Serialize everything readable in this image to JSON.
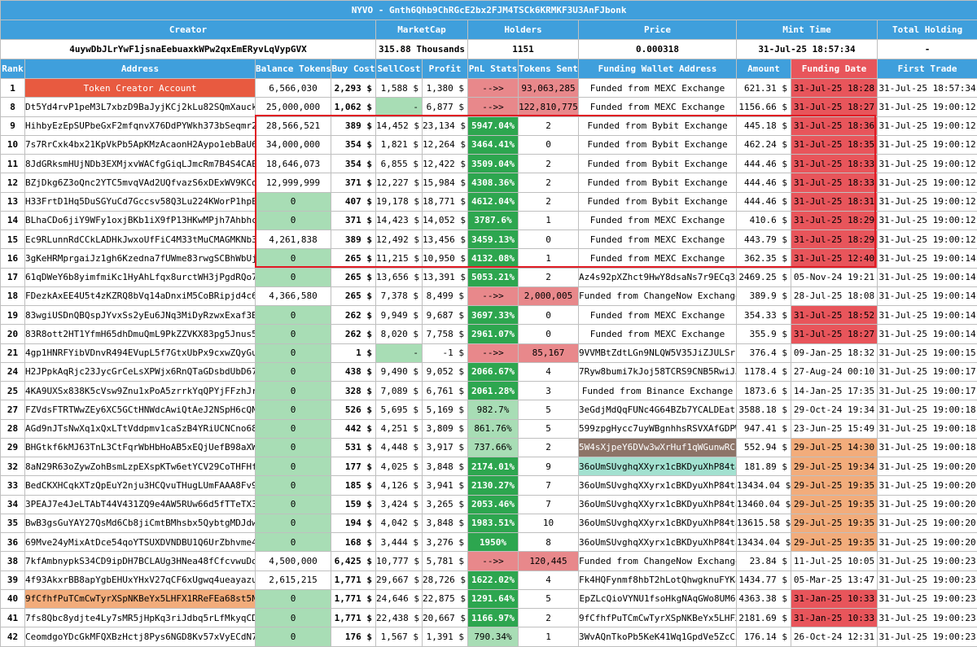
{
  "token": {
    "title": "NYVO - Gnth6Qhb9ChRGcE2bx2FJM4TSCk6KRMKF3U3AnFJbonk",
    "headers": {
      "creator": "Creator",
      "marketcap": "MarketCap",
      "holders": "Holders",
      "price": "Price",
      "mint_time": "Mint Time",
      "total_holding": "Total Holding"
    },
    "creator": "4uywDbJLrYwF1jsnaEebuaxkWPw2qxEmERyvLqVypGVX",
    "marketcap": "315.88 Thousands",
    "holders": "1151",
    "price": "0.000318",
    "mint_time": "31-Jul-25 18:57:34",
    "total_holding": "-"
  },
  "columns": [
    "Rank",
    "Address",
    "Balance Tokens",
    "Buy Cost",
    "SellCost",
    "Profit",
    "PnL Stats",
    "Tokens Sent",
    "Funding Wallet Address",
    "Amount",
    "Funding Date",
    "First Trade"
  ],
  "rows": [
    {
      "rank": "1",
      "address": "Token Creator Account",
      "balance": "6,566,030",
      "buy": "2,293 $",
      "sell": "1,588 $",
      "profit": "1,380 $",
      "pnl": "-->>",
      "sent": "93,063,285",
      "funding": "Funded from MEXC Exchange",
      "amount": "621.31 $",
      "fdate": "31-Jul-25 18:28",
      "first": "31-Jul-25 18:57:34",
      "c": {
        "address": "creator",
        "pnl": "pink",
        "sent": "pink",
        "fdate": "red"
      }
    },
    {
      "rank": "8",
      "address": "Dt5Yd4rvP1peM3L7xbzD9BaJyjKCj2kLu82SQmXauck2",
      "balance": "25,000,000",
      "buy": "1,062 $",
      "sell": "-",
      "profit": "6,877 $",
      "pnl": "-->>",
      "sent": "122,810,775",
      "funding": "Funded from MEXC Exchange",
      "amount": "1156.66 $",
      "fdate": "31-Jul-25 18:27",
      "first": "31-Jul-25 19:00:12",
      "c": {
        "sell": "green",
        "pnl": "pink",
        "sent": "pink",
        "fdate": "red"
      }
    },
    {
      "rank": "9",
      "address": "HihbyEzEpSUPbeGxF2mfqnvX76DdPYWkh373bSeqmr2",
      "balance": "28,566,521",
      "buy": "389 $",
      "sell": "14,452 $",
      "profit": "23,134 $",
      "pnl": "5947.04%",
      "sent": "2",
      "funding": "Funded from Bybit Exchange",
      "amount": "445.18 $",
      "fdate": "31-Jul-25 18:36",
      "first": "31-Jul-25 19:00:12",
      "c": {
        "pnl": "strong",
        "fdate": "red"
      }
    },
    {
      "rank": "10",
      "address": "7s7RrCxk4bx21KpVkPb5ApKMzAcaonH2Aypo1ebBaU6J",
      "balance": "34,000,000",
      "buy": "354 $",
      "sell": "1,821 $",
      "profit": "12,264 $",
      "pnl": "3464.41%",
      "sent": "0",
      "funding": "Funded from Bybit Exchange",
      "amount": "462.24 $",
      "fdate": "31-Jul-25 18:35",
      "first": "31-Jul-25 19:00:12",
      "c": {
        "pnl": "strong",
        "fdate": "red"
      }
    },
    {
      "rank": "11",
      "address": "8JdGRksmHUjNDb3EXMjxvWACfgGiqLJmcRm7B4S4CAE8",
      "balance": "18,646,073",
      "buy": "354 $",
      "sell": "6,855 $",
      "profit": "12,422 $",
      "pnl": "3509.04%",
      "sent": "2",
      "funding": "Funded from Bybit Exchange",
      "amount": "444.46 $",
      "fdate": "31-Jul-25 18:33",
      "first": "31-Jul-25 19:00:12",
      "c": {
        "pnl": "strong",
        "fdate": "red"
      }
    },
    {
      "rank": "12",
      "address": "BZjDkg6Z3oQnc2YTC5mvqVAd2UQfvazS6xDExWV9KCd",
      "balance": "12,999,999",
      "buy": "371 $",
      "sell": "12,227 $",
      "profit": "15,984 $",
      "pnl": "4308.36%",
      "sent": "2",
      "funding": "Funded from Bybit Exchange",
      "amount": "444.46 $",
      "fdate": "31-Jul-25 18:33",
      "first": "31-Jul-25 19:00:12",
      "c": {
        "pnl": "strong",
        "fdate": "red"
      }
    },
    {
      "rank": "13",
      "address": "H33FrtD1Hq5DuSGYuCd7Gccsv58Q3Lu224KWorP1hpEn",
      "balance": "0",
      "buy": "407 $",
      "sell": "19,178 $",
      "profit": "18,771 $",
      "pnl": "4612.04%",
      "sent": "2",
      "funding": "Funded from Bybit Exchange",
      "amount": "444.46 $",
      "fdate": "31-Jul-25 18:31",
      "first": "31-Jul-25 19:00:12",
      "c": {
        "balance": "green",
        "pnl": "strong",
        "fdate": "red"
      }
    },
    {
      "rank": "14",
      "address": "BLhaCDo6jiY9WFy1oxjBKb1iX9fP13HKwMPjh7Ahbhco",
      "balance": "0",
      "buy": "371 $",
      "sell": "14,423 $",
      "profit": "14,052 $",
      "pnl": "3787.6%",
      "sent": "1",
      "funding": "Funded from MEXC Exchange",
      "amount": "410.6 $",
      "fdate": "31-Jul-25 18:29",
      "first": "31-Jul-25 19:00:12",
      "c": {
        "balance": "green",
        "pnl": "strong",
        "fdate": "red"
      }
    },
    {
      "rank": "15",
      "address": "Ec9RLunnRdCCkLADHkJwxoUfFiC4M33tMuCMAGMKNb3d",
      "balance": "4,261,838",
      "buy": "389 $",
      "sell": "12,492 $",
      "profit": "13,456 $",
      "pnl": "3459.13%",
      "sent": "0",
      "funding": "Funded from MEXC Exchange",
      "amount": "443.79 $",
      "fdate": "31-Jul-25 18:29",
      "first": "31-Jul-25 19:00:12",
      "c": {
        "pnl": "strong",
        "fdate": "red"
      }
    },
    {
      "rank": "16",
      "address": "3gKeHRMprgaiJz1gh6Kzedna7fUWme83rwgSCBhWbUjM",
      "balance": "0",
      "buy": "265 $",
      "sell": "11,215 $",
      "profit": "10,950 $",
      "pnl": "4132.08%",
      "sent": "1",
      "funding": "Funded from MEXC Exchange",
      "amount": "362.35 $",
      "fdate": "31-Jul-25 12:40",
      "first": "31-Jul-25 19:00:14",
      "c": {
        "balance": "green",
        "pnl": "strong",
        "fdate": "red"
      }
    },
    {
      "rank": "17",
      "address": "61qDWeY6b8yimfmiKc1HyAhLfqx8urctWH3jPgdRQo7Y",
      "balance": "0",
      "buy": "265 $",
      "sell": "13,656 $",
      "profit": "13,391 $",
      "pnl": "5053.21%",
      "sent": "2",
      "funding": "Az4s92pXZhct9HwY8dsaNs7r9ECq35",
      "amount": "2469.25 $",
      "fdate": "05-Nov-24 19:21",
      "first": "31-Jul-25 19:00:14",
      "c": {
        "balance": "green",
        "pnl": "strong"
      }
    },
    {
      "rank": "18",
      "address": "FDezkAxEE4U5t4zKZRQ8bVq14aDnxiM5CoBRipjd4c6b",
      "balance": "4,366,580",
      "buy": "265 $",
      "sell": "7,378 $",
      "profit": "8,499 $",
      "pnl": "-->>",
      "sent": "2,000,005",
      "funding": "Funded from ChangeNow Exchange",
      "amount": "389.9 $",
      "fdate": "28-Jul-25 18:08",
      "first": "31-Jul-25 19:00:14",
      "c": {
        "pnl": "pink",
        "sent": "pink"
      }
    },
    {
      "rank": "19",
      "address": "83wgiUSDnQBQspJYvxSs2yEu6JNq3MiDyRzwxExaf3B7",
      "balance": "0",
      "buy": "262 $",
      "sell": "9,949 $",
      "profit": "9,687 $",
      "pnl": "3697.33%",
      "sent": "0",
      "funding": "Funded from MEXC Exchange",
      "amount": "354.33 $",
      "fdate": "31-Jul-25 18:52",
      "first": "31-Jul-25 19:00:14",
      "c": {
        "balance": "green",
        "pnl": "strong",
        "fdate": "red"
      }
    },
    {
      "rank": "20",
      "address": "83R8ott2HT1YfmH65dhDmuQmL9PkZZVKX83pg5Jnus5g",
      "balance": "0",
      "buy": "262 $",
      "sell": "8,020 $",
      "profit": "7,758 $",
      "pnl": "2961.07%",
      "sent": "0",
      "funding": "Funded from MEXC Exchange",
      "amount": "355.9 $",
      "fdate": "31-Jul-25 18:27",
      "first": "31-Jul-25 19:00:14",
      "c": {
        "balance": "green",
        "pnl": "strong",
        "fdate": "red"
      }
    },
    {
      "rank": "21",
      "address": "4gp1HNRFYibVDnvR494EVupL5f7GtxUbPx9cxwZQyGuA",
      "balance": "0",
      "buy": "1 $",
      "sell": "-",
      "profit": "-1 $",
      "pnl": "-->>",
      "sent": "85,167",
      "funding": "9VVMBtZdtLGn9NLQW5V35JiZJULSrf",
      "amount": "376.4 $",
      "fdate": "09-Jan-25 18:32",
      "first": "31-Jul-25 19:00:15",
      "c": {
        "balance": "green",
        "sell": "green",
        "pnl": "pink",
        "sent": "pink"
      }
    },
    {
      "rank": "24",
      "address": "H2JPpkAqRjc23JycGrCeLsXPWjx6RnQTaGDsbdUbD67P",
      "balance": "0",
      "buy": "438 $",
      "sell": "9,490 $",
      "profit": "9,052 $",
      "pnl": "2066.67%",
      "sent": "4",
      "funding": "7Ryw8bumi7kJoj58TCRS9CNB5RwiJJ",
      "amount": "1178.4 $",
      "fdate": "27-Aug-24 00:10",
      "first": "31-Jul-25 19:00:17",
      "c": {
        "balance": "green",
        "pnl": "strong"
      }
    },
    {
      "rank": "25",
      "address": "4KA9UXSx838K5cVsw9Znu1xPoA5zrrkYqQPYjFFzhJrb",
      "balance": "0",
      "buy": "328 $",
      "sell": "7,089 $",
      "profit": "6,761 $",
      "pnl": "2061.28%",
      "sent": "3",
      "funding": "Funded from Binance Exchange",
      "amount": "1873.6 $",
      "fdate": "14-Jan-25 17:35",
      "first": "31-Jul-25 19:00:17",
      "c": {
        "balance": "green",
        "pnl": "strong"
      }
    },
    {
      "rank": "27",
      "address": "FZVdsFTRTWwZEy6XC5GCtHNWdcAwiQtAeJ2NSpH6cQNz",
      "balance": "0",
      "buy": "526 $",
      "sell": "5,695 $",
      "profit": "5,169 $",
      "pnl": "982.7%",
      "sent": "5",
      "funding": "3eGdjMdQqFUNc4G64BZb7YCALDEatu",
      "amount": "3588.18 $",
      "fdate": "29-Oct-24 19:34",
      "first": "31-Jul-25 19:00:18",
      "c": {
        "balance": "green",
        "pnl": "green"
      }
    },
    {
      "rank": "28",
      "address": "AGd9nJTsNwXq1xQxLTtVddpmv1caSzB4YRiUCNCno68k",
      "balance": "0",
      "buy": "442 $",
      "sell": "4,251 $",
      "profit": "3,809 $",
      "pnl": "861.76%",
      "sent": "5",
      "funding": "599zpgHycc7uyWBgnhhsRSVXAfGDPW",
      "amount": "947.41 $",
      "fdate": "23-Jun-25 15:49",
      "first": "31-Jul-25 19:00:18",
      "c": {
        "balance": "green",
        "pnl": "green"
      }
    },
    {
      "rank": "29",
      "address": "BHGtkf6kMJ63TnL3CtFqrWbHbHoAB5xEQjUefB98aXWk",
      "balance": "0",
      "buy": "531 $",
      "sell": "4,448 $",
      "profit": "3,917 $",
      "pnl": "737.66%",
      "sent": "2",
      "funding": "5W4sXjpeY6DVw3wXrHuf1qWGunwRCj",
      "amount": "552.94 $",
      "fdate": "29-Jul-25 14:30",
      "first": "31-Jul-25 19:00:18",
      "c": {
        "balance": "green",
        "pnl": "green",
        "funding": "brown",
        "fdate": "orange"
      }
    },
    {
      "rank": "32",
      "address": "8aN29R63oZywZohBsmLzpEXspKTw6etYCV29CoTHFHf7",
      "balance": "0",
      "buy": "177 $",
      "sell": "4,025 $",
      "profit": "3,848 $",
      "pnl": "2174.01%",
      "sent": "9",
      "funding": "36oUmSUvghqXXyrx1cBKDyuXhP84ta",
      "amount": "181.89 $",
      "fdate": "29-Jul-25 19:34",
      "first": "31-Jul-25 19:00:20",
      "c": {
        "balance": "green",
        "pnl": "strong",
        "funding": "teal",
        "fdate": "orange"
      }
    },
    {
      "rank": "33",
      "address": "BedCKXHCqkXTzQpEuY2nju3HCQvuTHugLUmFAAA8Fv9s",
      "balance": "0",
      "buy": "185 $",
      "sell": "4,126 $",
      "profit": "3,941 $",
      "pnl": "2130.27%",
      "sent": "7",
      "funding": "36oUmSUvghqXXyrx1cBKDyuXhP84ta",
      "amount": "13434.04 $",
      "fdate": "29-Jul-25 19:35",
      "first": "31-Jul-25 19:00:20",
      "c": {
        "balance": "green",
        "pnl": "strong",
        "fdate": "orange"
      }
    },
    {
      "rank": "34",
      "address": "3PEAJ7e4JeLTAbT44V431ZQ9e4AW5RUw66d5fTTeTX3C",
      "balance": "0",
      "buy": "159 $",
      "sell": "3,424 $",
      "profit": "3,265 $",
      "pnl": "2053.46%",
      "sent": "7",
      "funding": "36oUmSUvghqXXyrx1cBKDyuXhP84ta",
      "amount": "13460.04 $",
      "fdate": "29-Jul-25 19:35",
      "first": "31-Jul-25 19:00:20",
      "c": {
        "balance": "green",
        "pnl": "strong",
        "fdate": "orange"
      }
    },
    {
      "rank": "35",
      "address": "BwB3gsGuYAY27QsMd6Cb8jiCmtBMhsbx5QybtgMDJdwt",
      "balance": "0",
      "buy": "194 $",
      "sell": "4,042 $",
      "profit": "3,848 $",
      "pnl": "1983.51%",
      "sent": "10",
      "funding": "36oUmSUvghqXXyrx1cBKDyuXhP84ta",
      "amount": "13615.58 $",
      "fdate": "29-Jul-25 19:35",
      "first": "31-Jul-25 19:00:20",
      "c": {
        "balance": "green",
        "pnl": "strong",
        "fdate": "orange"
      }
    },
    {
      "rank": "36",
      "address": "69Mve24yMixAtDce54qoYTSUXDVNDBU1Q6UrZbhvme4y",
      "balance": "0",
      "buy": "168 $",
      "sell": "3,444 $",
      "profit": "3,276 $",
      "pnl": "1950%",
      "sent": "8",
      "funding": "36oUmSUvghqXXyrx1cBKDyuXhP84ta",
      "amount": "13434.04 $",
      "fdate": "29-Jul-25 19:35",
      "first": "31-Jul-25 19:00:20",
      "c": {
        "balance": "green",
        "pnl": "strong",
        "fdate": "orange"
      }
    },
    {
      "rank": "38",
      "address": "7kfAmbnypkS34CD9ipDH7BCLAUg3HNea48fCfcvwuDon",
      "balance": "4,500,000",
      "buy": "6,425 $",
      "sell": "10,777 $",
      "profit": "5,781 $",
      "pnl": "-->>",
      "sent": "120,445",
      "funding": "Funded from ChangeNow Exchange",
      "amount": "23.84 $",
      "fdate": "11-Jul-25 10:05",
      "first": "31-Jul-25 19:00:23",
      "c": {
        "pnl": "pink",
        "sent": "pink"
      }
    },
    {
      "rank": "39",
      "address": "4f93AkxrBB8apYgbEHUxYHxV27qCF6xUgwq4ueayazu4",
      "balance": "2,615,215",
      "buy": "1,771 $",
      "sell": "29,667 $",
      "profit": "28,726 $",
      "pnl": "1622.02%",
      "sent": "4",
      "funding": "Fk4HQFynmf8hbT2hLotQhwgknuFYKa",
      "amount": "1434.77 $",
      "fdate": "05-Mar-25 13:47",
      "first": "31-Jul-25 19:00:23",
      "c": {
        "pnl": "strong"
      }
    },
    {
      "rank": "40",
      "address": "9fCfhfPuTCmCwTyrXSpNKBeYx5LHFX1RReFEa68st5NZ",
      "balance": "0",
      "buy": "1,771 $",
      "sell": "24,646 $",
      "profit": "22,875 $",
      "pnl": "1291.64%",
      "sent": "5",
      "funding": "EpZLcQioVYNU1fsoHkgNAqGWo8UM6",
      "amount": "4363.38 $",
      "fdate": "31-Jan-25 10:33",
      "first": "31-Jul-25 19:00:23",
      "c": {
        "address": "orange",
        "balance": "green",
        "pnl": "strong",
        "fdate": "red"
      }
    },
    {
      "rank": "41",
      "address": "7fs8Qbc8ydjte4Ly7sMR5jHpKq3riJdbq5rLfMkyqCDG",
      "balance": "0",
      "buy": "1,771 $",
      "sell": "22,438 $",
      "profit": "20,667 $",
      "pnl": "1166.97%",
      "sent": "2",
      "funding": "9fCfhfPuTCmCwTyrXSpNKBeYx5LHFX",
      "amount": "2181.69 $",
      "fdate": "31-Jan-25 10:33",
      "first": "31-Jul-25 19:00:23",
      "c": {
        "balance": "green",
        "pnl": "strong",
        "fdate": "red"
      }
    },
    {
      "rank": "42",
      "address": "CeomdgoYDcGkMFQXBzHctj8Pys6NGD8Kv57xVyECdN7P",
      "balance": "0",
      "buy": "176 $",
      "sell": "1,567 $",
      "profit": "1,391 $",
      "pnl": "790.34%",
      "sent": "1",
      "funding": "3WvAQnTkoPb5KeK41Wq1GpdVe5ZcCx",
      "amount": "176.14 $",
      "fdate": "26-Oct-24 12:31",
      "first": "31-Jul-25 19:00:23",
      "c": {
        "balance": "green",
        "pnl": "green"
      }
    }
  ],
  "colors": {
    "header": "#3f9fdc",
    "highlight_header": "#e8555b",
    "green": "#a8ddb5",
    "strong_green": "#2da64f",
    "pink": "#e8888b",
    "red": "#e8555b",
    "orange": "#f2ac7b",
    "teal": "#a3e1d0",
    "brown": "#8d7468",
    "box": "#e01b24"
  }
}
